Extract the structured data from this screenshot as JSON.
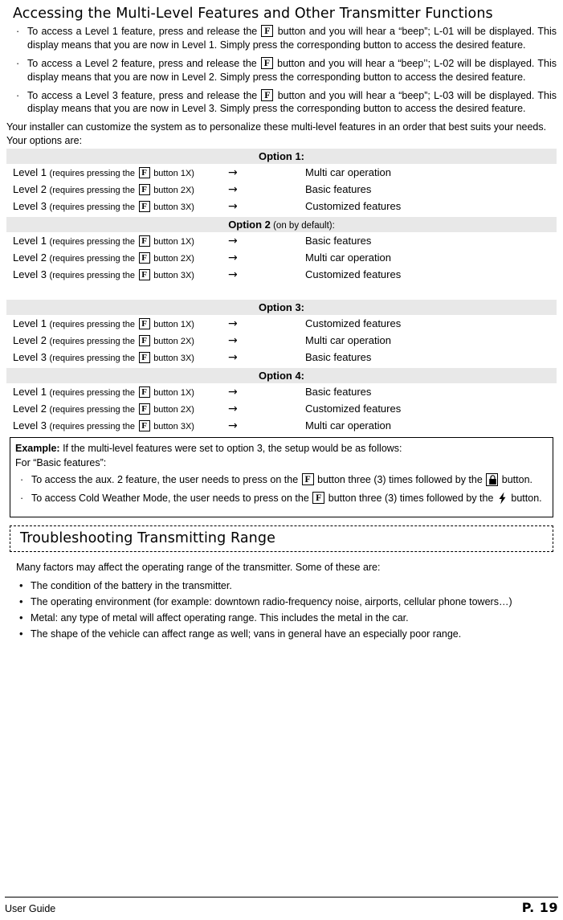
{
  "section": {
    "title": "Accessing the Multi-Level Features and Other Transmitter Functions",
    "bullets": [
      {
        "pre": "To access a Level 1 feature, press and release the",
        "icon": "f-button-icon",
        "post": "button and you will hear a “beep”; L-01 will be displayed. This display means that you are now in Level 1.  Simply press the corresponding button to access the desired feature."
      },
      {
        "pre": "To access a Level 2 feature, press and release the",
        "icon": "f-button-icon",
        "post": "button and you will hear a “beep’’; L-02 will be displayed. This display means that you are now in Level 2.  Simply press the corresponding button to access the desired feature."
      },
      {
        "pre": "To access a Level 3 feature, press and release the",
        "icon": "f-button-icon",
        "post": "button and you will hear a “beep”;  L-03 will be displayed. This display means that you are now in Level 3.  Simply press the corresponding button to access the desired feature."
      }
    ],
    "intro": "Your installer can customize the system as to personalize these multi-level features in an order that best suits your needs. Your options are:"
  },
  "options": [
    {
      "header": "Option 1:",
      "header_sub": "",
      "rows": [
        {
          "level": "Level 1",
          "req": "(requires pressing the",
          "req_end": "button 1X)",
          "arrow": "→",
          "value": "Multi car operation"
        },
        {
          "level": "Level 2",
          "req": "(requires pressing the",
          "req_end": "button 2X)",
          "arrow": "→",
          "value": "Basic features"
        },
        {
          "level": "Level 3",
          "req": "(requires pressing the",
          "req_end": "button 3X)",
          "arrow": "→",
          "value": "Customized features"
        }
      ]
    },
    {
      "header": "Option 2",
      "header_sub": " (on by default):",
      "rows": [
        {
          "level": "Level 1",
          "req": "(requires pressing the",
          "req_end": "button 1X)",
          "arrow": "→",
          "value": "Basic features"
        },
        {
          "level": "Level 2",
          "req": "(requires pressing the",
          "req_end": "button 2X)",
          "arrow": "→",
          "value": "Multi car operation"
        },
        {
          "level": "Level 3",
          "req": "(requires pressing the",
          "req_end": "button 3X)",
          "arrow": "→",
          "value": "Customized features"
        }
      ]
    },
    {
      "header": "Option 3:",
      "header_sub": "",
      "rows": [
        {
          "level": "Level 1",
          "req": "(requires pressing the",
          "req_end": "button 1X)",
          "arrow": "→",
          "value": "Customized features"
        },
        {
          "level": "Level 2",
          "req": "(requires pressing the",
          "req_end": "button 2X)",
          "arrow": "→",
          "value": "Multi car operation"
        },
        {
          "level": "Level 3",
          "req": "(requires pressing the",
          "req_end": "button 3X)",
          "arrow": "→",
          "value": "Basic features"
        }
      ]
    },
    {
      "header": "Option 4:",
      "header_sub": "",
      "rows": [
        {
          "level": "Level 1",
          "req": "(requires pressing the",
          "req_end": "button 1X)",
          "arrow": "→",
          "value": "Basic features"
        },
        {
          "level": "Level 2",
          "req": "(requires pressing the",
          "req_end": "button 2X)",
          "arrow": "→",
          "value": "Customized features"
        },
        {
          "level": "Level 3",
          "req": "(requires pressing the",
          "req_end": "button 3X)",
          "arrow": "→",
          "value": "Multi car operation"
        }
      ]
    }
  ],
  "example": {
    "title": "Example:",
    "title_rest": " If the multi-level features were set to option 3, the setup would be as follows:",
    "line2": "For “Basic features”:",
    "items": [
      {
        "pre": "To access the aux. 2 feature, the user needs to press on the",
        "mid": "button three (3) times followed by the",
        "post": "button."
      },
      {
        "pre": "To access Cold Weather Mode, the user needs to press on the",
        "mid": "button three (3) times followed by the",
        "post": "button."
      }
    ]
  },
  "troubleshooting": {
    "title": "Troubleshooting Transmitting Range",
    "intro": "Many factors may affect the operating range of the transmitter.  Some of these are:",
    "items": [
      "The condition of the battery in the transmitter.",
      "The operating environment (for example: downtown radio-frequency noise, airports, cellular phone towers…)",
      "Metal: any type of metal will affect operating range. This includes the metal in the car.",
      "The shape of the vehicle can affect range as well; vans in general have an especially poor range."
    ]
  },
  "footer": {
    "left": "User Guide",
    "right": "P. 19"
  }
}
